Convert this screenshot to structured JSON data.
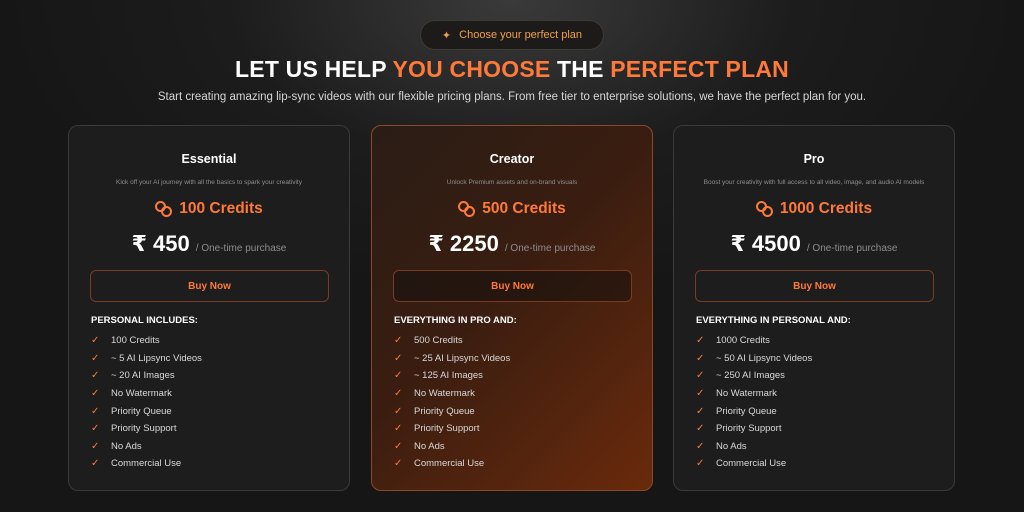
{
  "badge": {
    "icon": "sparkle-icon",
    "label": "Choose your perfect plan"
  },
  "headline": {
    "part1": "LET US HELP ",
    "accent1": "YOU CHOOSE",
    "part2": " THE ",
    "accent2": "PERFECT PLAN"
  },
  "subheadline": "Start creating amazing lip-sync videos with our flexible pricing plans. From free tier to enterprise solutions, we have the perfect plan for you.",
  "colors": {
    "accent": "#ff7a3a",
    "background": "#1c1c1c",
    "card": "#1d1d1d"
  },
  "plans": [
    {
      "name": "Essential",
      "description": "Kick off your AI journey with all the basics to spark your creativity",
      "credits": "100 Credits",
      "price": "₹ 450",
      "price_note": "/ One-time purchase",
      "button": "Buy Now",
      "includes_title": "PERSONAL INCLUDES:",
      "features": [
        "100 Credits",
        "~ 5 AI Lipsync Videos",
        "~ 20 AI Images",
        "No Watermark",
        "Priority Queue",
        "Priority Support",
        "No Ads",
        "Commercial Use"
      ]
    },
    {
      "name": "Creator",
      "description": "Unlock Premium assets and on-brand visuals",
      "credits": "500 Credits",
      "price": "₹ 2250",
      "price_note": "/ One-time purchase",
      "button": "Buy Now",
      "includes_title": "EVERYTHING IN PRO AND:",
      "features": [
        "500 Credits",
        "~ 25 AI Lipsync Videos",
        "~ 125 AI Images",
        "No Watermark",
        "Priority Queue",
        "Priority Support",
        "No Ads",
        "Commercial Use"
      ]
    },
    {
      "name": "Pro",
      "description": "Boost your creativity with full access to all video, image, and audio AI models",
      "credits": "1000 Credits",
      "price": "₹ 4500",
      "price_note": "/ One-time purchase",
      "button": "Buy Now",
      "includes_title": "EVERYTHING IN PERSONAL AND:",
      "features": [
        "1000 Credits",
        "~ 50 AI Lipsync Videos",
        "~ 250 AI Images",
        "No Watermark",
        "Priority Queue",
        "Priority Support",
        "No Ads",
        "Commercial Use"
      ]
    }
  ]
}
